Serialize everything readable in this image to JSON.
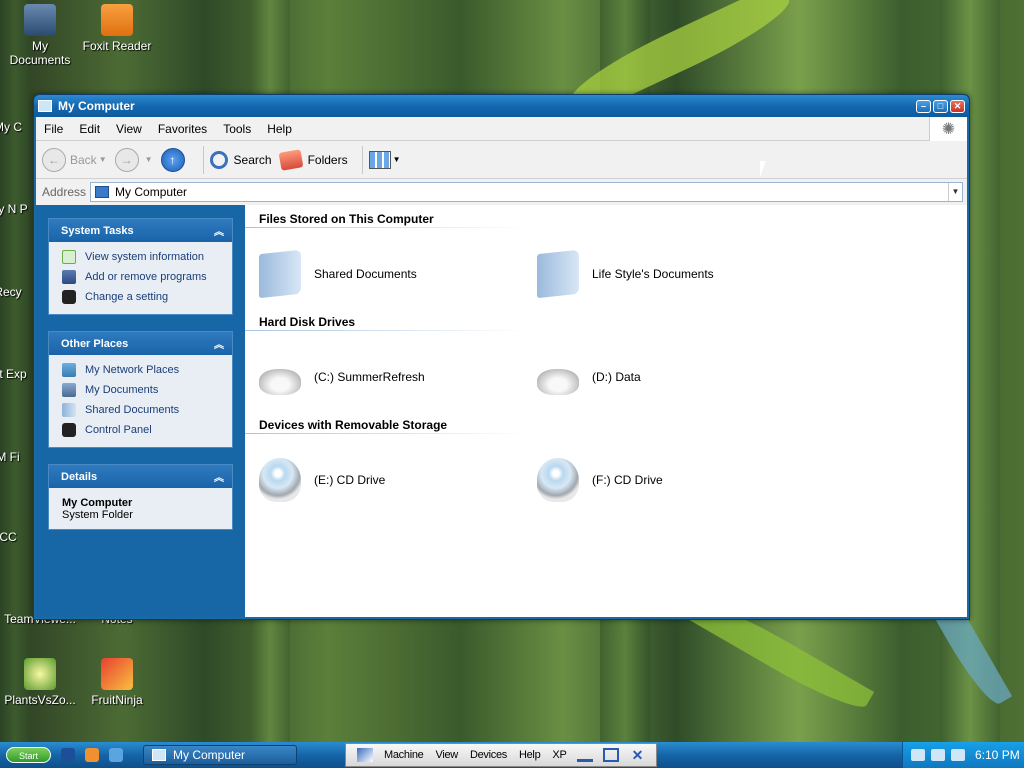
{
  "desktop": {
    "icons": [
      {
        "label": "My Documents",
        "name": "my-documents"
      },
      {
        "label": "Foxit Reader",
        "name": "foxit-reader"
      },
      {
        "label": "My C",
        "name": "my-computer"
      },
      {
        "label": "My N P",
        "name": "my-network"
      },
      {
        "label": "Recy",
        "name": "recycle-bin"
      },
      {
        "label": "Int Exp",
        "name": "internet-explorer"
      },
      {
        "label": "M Fi",
        "name": "mozilla-firefox"
      },
      {
        "label": "CC",
        "name": "ccleaner"
      },
      {
        "label": "TeamViewe...",
        "name": "teamviewer"
      },
      {
        "label": "Notes",
        "name": "notes"
      },
      {
        "label": "PlantsVsZo...",
        "name": "plants-vs-zombies"
      },
      {
        "label": "FruitNinja",
        "name": "fruit-ninja"
      }
    ]
  },
  "window": {
    "title": "My Computer",
    "menu": [
      "File",
      "Edit",
      "View",
      "Favorites",
      "Tools",
      "Help"
    ],
    "toolbar": {
      "back": "Back",
      "search": "Search",
      "folders": "Folders"
    },
    "address": {
      "label": "Address",
      "value": "My Computer"
    }
  },
  "sidebar": {
    "system_tasks": {
      "title": "System Tasks",
      "items": [
        "View system information",
        "Add or remove programs",
        "Change a setting"
      ]
    },
    "other_places": {
      "title": "Other Places",
      "items": [
        "My Network Places",
        "My Documents",
        "Shared Documents",
        "Control Panel"
      ]
    },
    "details": {
      "title": "Details",
      "name": "My Computer",
      "type": "System Folder"
    }
  },
  "content": {
    "sections": [
      {
        "title": "Files Stored on This Computer",
        "items": [
          {
            "label": "Shared Documents",
            "icon": "folder-icon"
          },
          {
            "label": "Life Style's Documents",
            "icon": "folder-icon"
          }
        ]
      },
      {
        "title": "Hard Disk Drives",
        "items": [
          {
            "label": "(C:) SummerRefresh",
            "icon": "hard-disk-icon"
          },
          {
            "label": "(D:) Data",
            "icon": "hard-disk-icon"
          }
        ]
      },
      {
        "title": "Devices with Removable Storage",
        "items": [
          {
            "label": "(E:) CD Drive",
            "icon": "cd-drive-icon"
          },
          {
            "label": "(F:) CD Drive",
            "icon": "cd-drive-icon"
          }
        ]
      }
    ]
  },
  "taskbar": {
    "start": "Start",
    "task_button": "My Computer",
    "vm_menu": [
      "Machine",
      "View",
      "Devices",
      "Help",
      "XP"
    ],
    "clock": "6:10 PM"
  },
  "colors": {
    "titlebar": "#1368b0",
    "sidebar": "#1767a6",
    "task_link": "#1a3e7a",
    "taskbar": "#1565a8"
  }
}
